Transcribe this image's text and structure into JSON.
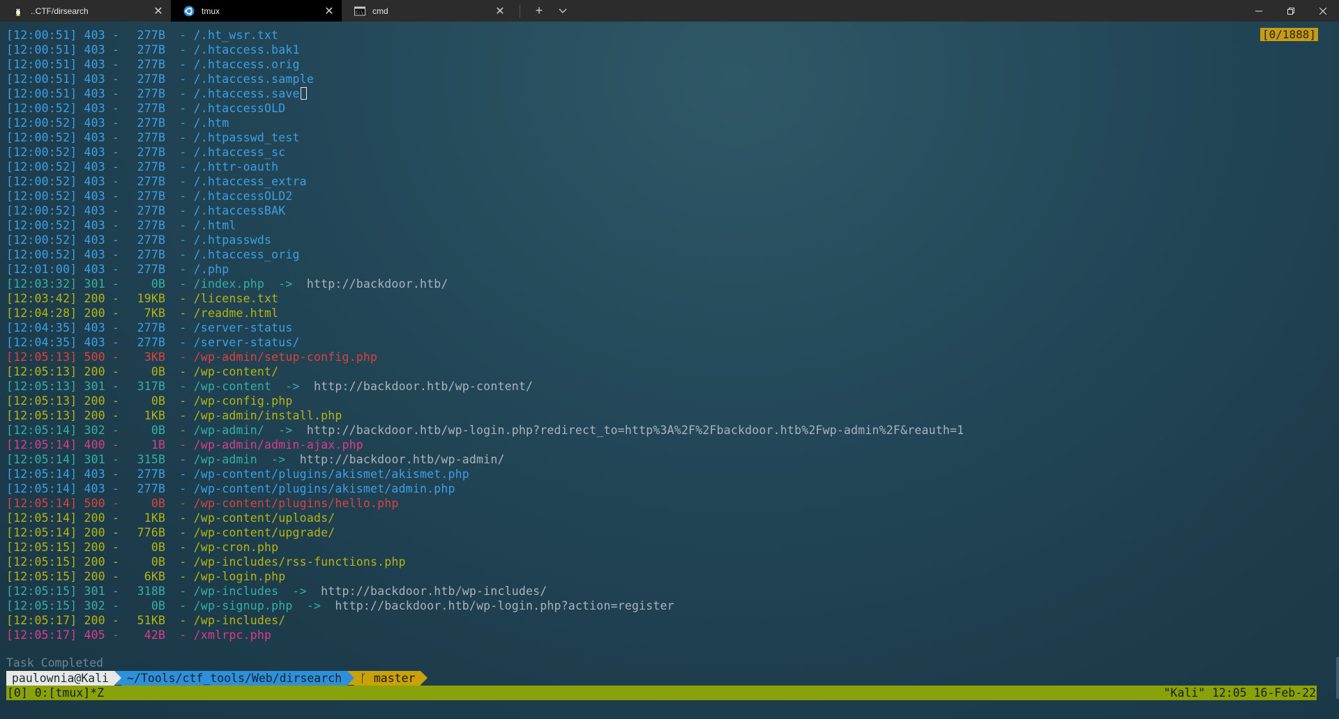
{
  "tabs": [
    {
      "title": "..CTF/dirsearch",
      "icon": "linux-penguin-icon",
      "active": false
    },
    {
      "title": "tmux",
      "icon": "ubuntu-icon",
      "active": true
    },
    {
      "title": "cmd",
      "icon": "cmd-icon",
      "active": false
    }
  ],
  "window": {
    "new_tab": "+",
    "dropdown": "⌵"
  },
  "counter": "[0/1888]",
  "log": [
    {
      "time": "[12:00:51]",
      "code": "403",
      "size": "277B",
      "path": "/.ht_wsr.txt",
      "color": "blue",
      "redirect": ""
    },
    {
      "time": "[12:00:51]",
      "code": "403",
      "size": "277B",
      "path": "/.htaccess.bak1",
      "color": "blue",
      "redirect": ""
    },
    {
      "time": "[12:00:51]",
      "code": "403",
      "size": "277B",
      "path": "/.htaccess.orig",
      "color": "blue",
      "redirect": ""
    },
    {
      "time": "[12:00:51]",
      "code": "403",
      "size": "277B",
      "path": "/.htaccess.sample",
      "color": "blue",
      "redirect": ""
    },
    {
      "time": "[12:00:51]",
      "code": "403",
      "size": "277B",
      "path": "/.htaccess.save",
      "color": "blue",
      "redirect": "",
      "cursor": true
    },
    {
      "time": "[12:00:52]",
      "code": "403",
      "size": "277B",
      "path": "/.htaccessOLD",
      "color": "blue",
      "redirect": ""
    },
    {
      "time": "[12:00:52]",
      "code": "403",
      "size": "277B",
      "path": "/.htm",
      "color": "blue",
      "redirect": ""
    },
    {
      "time": "[12:00:52]",
      "code": "403",
      "size": "277B",
      "path": "/.htpasswd_test",
      "color": "blue",
      "redirect": ""
    },
    {
      "time": "[12:00:52]",
      "code": "403",
      "size": "277B",
      "path": "/.htaccess_sc",
      "color": "blue",
      "redirect": ""
    },
    {
      "time": "[12:00:52]",
      "code": "403",
      "size": "277B",
      "path": "/.httr-oauth",
      "color": "blue",
      "redirect": ""
    },
    {
      "time": "[12:00:52]",
      "code": "403",
      "size": "277B",
      "path": "/.htaccess_extra",
      "color": "blue",
      "redirect": ""
    },
    {
      "time": "[12:00:52]",
      "code": "403",
      "size": "277B",
      "path": "/.htaccessOLD2",
      "color": "blue",
      "redirect": ""
    },
    {
      "time": "[12:00:52]",
      "code": "403",
      "size": "277B",
      "path": "/.htaccessBAK",
      "color": "blue",
      "redirect": ""
    },
    {
      "time": "[12:00:52]",
      "code": "403",
      "size": "277B",
      "path": "/.html",
      "color": "blue",
      "redirect": ""
    },
    {
      "time": "[12:00:52]",
      "code": "403",
      "size": "277B",
      "path": "/.htpasswds",
      "color": "blue",
      "redirect": ""
    },
    {
      "time": "[12:00:52]",
      "code": "403",
      "size": "277B",
      "path": "/.htaccess_orig",
      "color": "blue",
      "redirect": ""
    },
    {
      "time": "[12:01:00]",
      "code": "403",
      "size": "277B",
      "path": "/.php",
      "color": "blue",
      "redirect": ""
    },
    {
      "time": "[12:03:32]",
      "code": "301",
      "size": "0B",
      "path": "/index.php",
      "color": "teal",
      "redirect": "http://backdoor.htb/"
    },
    {
      "time": "[12:03:42]",
      "code": "200",
      "size": "19KB",
      "path": "/license.txt",
      "color": "yellow",
      "redirect": ""
    },
    {
      "time": "[12:04:28]",
      "code": "200",
      "size": "7KB",
      "path": "/readme.html",
      "color": "yellow",
      "redirect": ""
    },
    {
      "time": "[12:04:35]",
      "code": "403",
      "size": "277B",
      "path": "/server-status",
      "color": "blue",
      "redirect": ""
    },
    {
      "time": "[12:04:35]",
      "code": "403",
      "size": "277B",
      "path": "/server-status/",
      "color": "blue",
      "redirect": ""
    },
    {
      "time": "[12:05:13]",
      "code": "500",
      "size": "3KB",
      "path": "/wp-admin/setup-config.php",
      "color": "red",
      "redirect": ""
    },
    {
      "time": "[12:05:13]",
      "code": "200",
      "size": "0B",
      "path": "/wp-content/",
      "color": "yellow",
      "redirect": ""
    },
    {
      "time": "[12:05:13]",
      "code": "301",
      "size": "317B",
      "path": "/wp-content",
      "color": "teal",
      "redirect": "http://backdoor.htb/wp-content/"
    },
    {
      "time": "[12:05:13]",
      "code": "200",
      "size": "0B",
      "path": "/wp-config.php",
      "color": "yellow",
      "redirect": ""
    },
    {
      "time": "[12:05:13]",
      "code": "200",
      "size": "1KB",
      "path": "/wp-admin/install.php",
      "color": "yellow",
      "redirect": ""
    },
    {
      "time": "[12:05:14]",
      "code": "302",
      "size": "0B",
      "path": "/wp-admin/",
      "color": "teal",
      "redirect": "http://backdoor.htb/wp-login.php?redirect_to=http%3A%2F%2Fbackdoor.htb%2Fwp-admin%2F&reauth=1"
    },
    {
      "time": "[12:05:14]",
      "code": "400",
      "size": "1B",
      "path": "/wp-admin/admin-ajax.php",
      "color": "magenta",
      "redirect": ""
    },
    {
      "time": "[12:05:14]",
      "code": "301",
      "size": "315B",
      "path": "/wp-admin",
      "color": "teal",
      "redirect": "http://backdoor.htb/wp-admin/"
    },
    {
      "time": "[12:05:14]",
      "code": "403",
      "size": "277B",
      "path": "/wp-content/plugins/akismet/akismet.php",
      "color": "blue",
      "redirect": ""
    },
    {
      "time": "[12:05:14]",
      "code": "403",
      "size": "277B",
      "path": "/wp-content/plugins/akismet/admin.php",
      "color": "blue",
      "redirect": ""
    },
    {
      "time": "[12:05:14]",
      "code": "500",
      "size": "0B",
      "path": "/wp-content/plugins/hello.php",
      "color": "red",
      "redirect": ""
    },
    {
      "time": "[12:05:14]",
      "code": "200",
      "size": "1KB",
      "path": "/wp-content/uploads/",
      "color": "yellow",
      "redirect": ""
    },
    {
      "time": "[12:05:14]",
      "code": "200",
      "size": "776B",
      "path": "/wp-content/upgrade/",
      "color": "yellow",
      "redirect": ""
    },
    {
      "time": "[12:05:15]",
      "code": "200",
      "size": "0B",
      "path": "/wp-cron.php",
      "color": "yellow",
      "redirect": ""
    },
    {
      "time": "[12:05:15]",
      "code": "200",
      "size": "0B",
      "path": "/wp-includes/rss-functions.php",
      "color": "yellow",
      "redirect": ""
    },
    {
      "time": "[12:05:15]",
      "code": "200",
      "size": "6KB",
      "path": "/wp-login.php",
      "color": "yellow",
      "redirect": ""
    },
    {
      "time": "[12:05:15]",
      "code": "301",
      "size": "318B",
      "path": "/wp-includes",
      "color": "teal",
      "redirect": "http://backdoor.htb/wp-includes/"
    },
    {
      "time": "[12:05:15]",
      "code": "302",
      "size": "0B",
      "path": "/wp-signup.php",
      "color": "teal",
      "redirect": "http://backdoor.htb/wp-login.php?action=register"
    },
    {
      "time": "[12:05:17]",
      "code": "200",
      "size": "51KB",
      "path": "/wp-includes/",
      "color": "yellow",
      "redirect": ""
    },
    {
      "time": "[12:05:17]",
      "code": "405",
      "size": "42B",
      "path": "/xmlrpc.php",
      "color": "magenta",
      "redirect": ""
    }
  ],
  "task_completed": "Task Completed",
  "prompt": {
    "user": "paulownia@Kali",
    "path": "~/Tools/ctf_tools/Web/dirsearch",
    "git": "ᚴ master"
  },
  "status": {
    "left": "[0] 0:[tmux]*Z",
    "right": "\"Kali\" 12:05 16-Feb-22"
  },
  "colors": {
    "blue": "#3ca0e8",
    "teal": "#35b0a8",
    "yellow": "#b5b612",
    "red": "#e0413b",
    "magenta": "#df3b8a",
    "status_bar": "#8aa20a",
    "counter": "#c79a17"
  }
}
